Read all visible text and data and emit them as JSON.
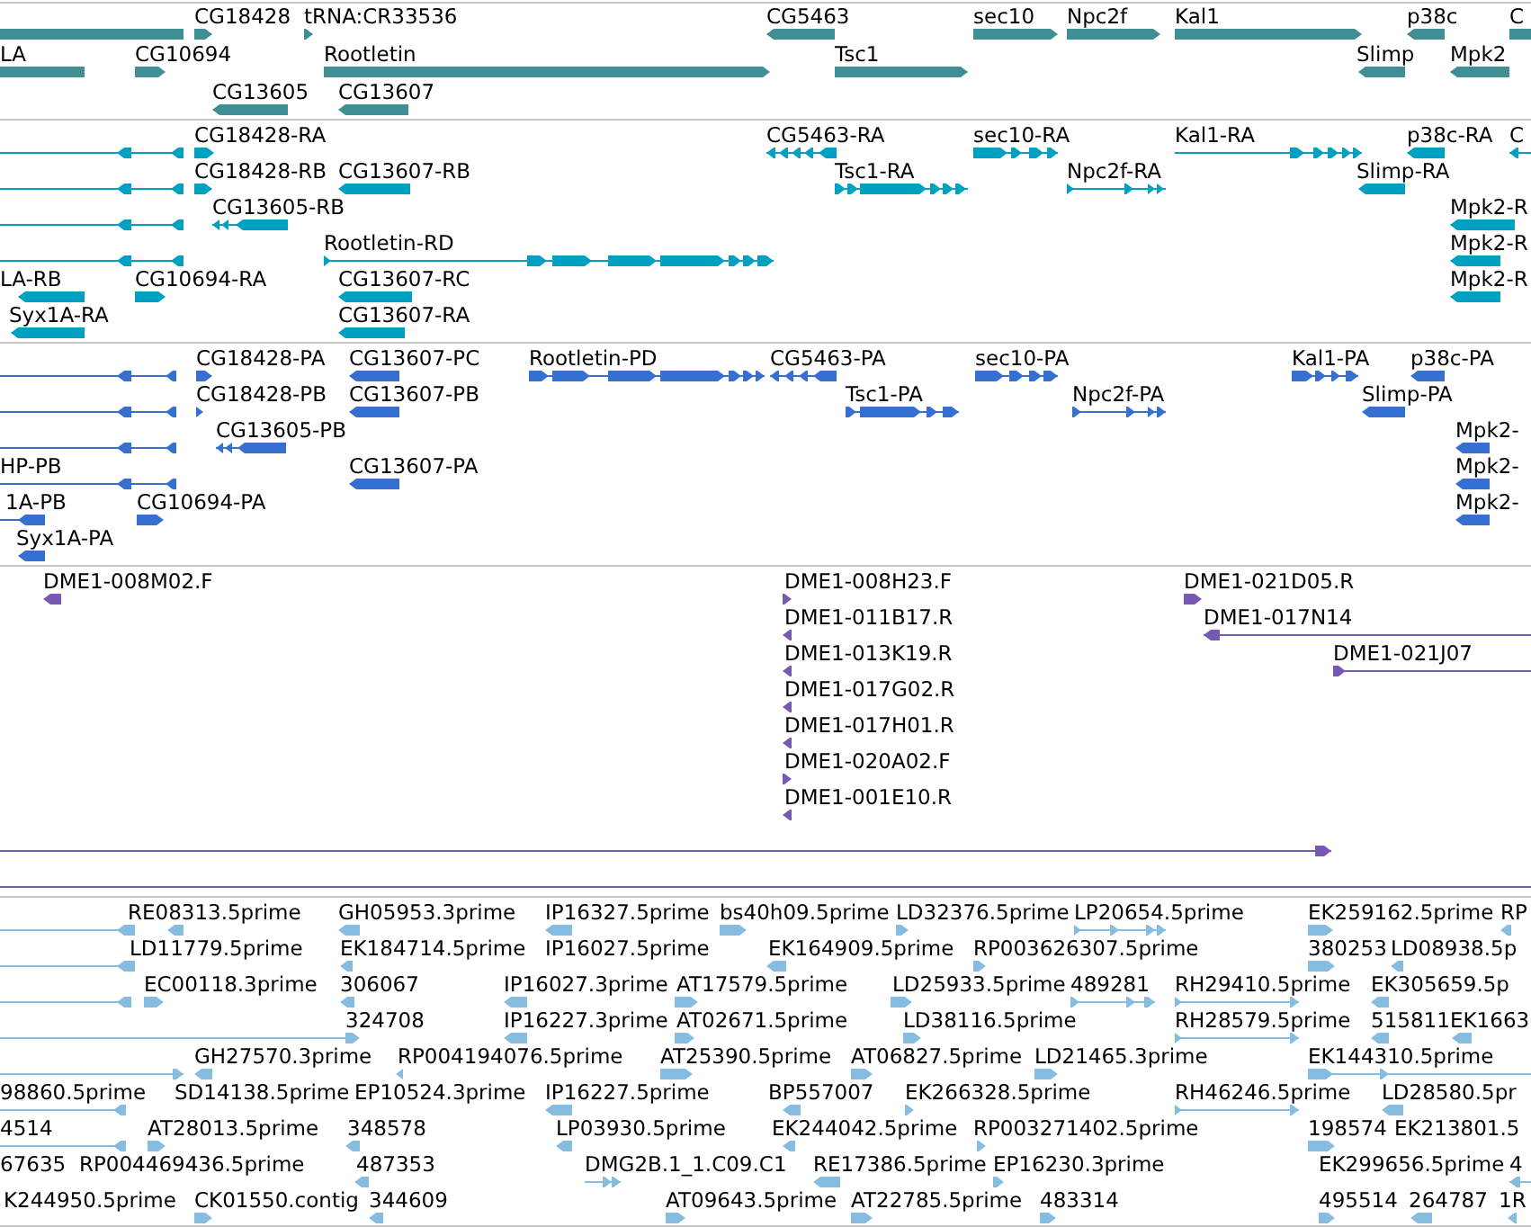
{
  "tracks": [
    {
      "color": "#408f95",
      "lanes": [
        {
          "features": [
            {
              "kind": "block"
            },
            {
              "label": "CG18428",
              "kind": "block",
              "forward": true
            },
            {
              "label": "tRNA:CR33536",
              "kind": "block",
              "forward": true
            },
            {
              "label": "CG5463",
              "kind": "block",
              "forward": false
            },
            {
              "label": "sec10",
              "kind": "block",
              "forward": true
            },
            {
              "label": "Npc2f",
              "kind": "block",
              "forward": true
            },
            {
              "label": "Kal1",
              "kind": "block",
              "forward": true
            },
            {
              "label": "p38c",
              "kind": "block",
              "forward": false
            },
            {
              "label": "C",
              "kind": "block"
            }
          ]
        },
        {
          "features": [
            {
              "label": "LA",
              "kind": "block"
            },
            {
              "label": "CG10694",
              "kind": "block",
              "forward": true
            },
            {
              "label": "Rootletin",
              "kind": "block",
              "forward": true
            },
            {
              "label": "Tsc1",
              "kind": "block",
              "forward": true
            },
            {
              "label": "Slimp",
              "kind": "block",
              "forward": false
            },
            {
              "label": "Mpk2",
              "kind": "block",
              "forward": false
            }
          ]
        },
        {
          "features": [
            {
              "label": "CG13605",
              "kind": "block",
              "forward": false
            },
            {
              "label": "CG13607",
              "kind": "block",
              "forward": false
            }
          ]
        }
      ]
    },
    {
      "color": "#00a0c0",
      "lanes": [
        {
          "features": [
            {
              "kind": "spliced",
              "forward": false
            },
            {
              "label": "CG18428-RA",
              "kind": "block",
              "forward": true
            },
            {
              "label": "CG5463-RA",
              "kind": "spliced",
              "forward": false
            },
            {
              "label": "sec10-RA",
              "kind": "spliced",
              "forward": true
            },
            {
              "label": "Kal1-RA",
              "kind": "spliced",
              "forward": true
            },
            {
              "label": "p38c-RA",
              "kind": "block",
              "forward": false
            },
            {
              "label": "C",
              "kind": "spliced",
              "forward": false
            }
          ]
        },
        {
          "features": [
            {
              "kind": "spliced",
              "forward": false
            },
            {
              "label": "CG18428-RB",
              "kind": "block",
              "forward": true
            },
            {
              "label": "CG13607-RB",
              "kind": "block",
              "forward": false
            },
            {
              "label": "Tsc1-RA",
              "kind": "spliced",
              "forward": true
            },
            {
              "label": "Npc2f-RA",
              "kind": "spliced",
              "forward": true
            },
            {
              "label": "Slimp-RA",
              "kind": "block",
              "forward": false
            }
          ]
        },
        {
          "features": [
            {
              "kind": "spliced",
              "forward": false
            },
            {
              "label": "CG13605-RB",
              "kind": "spliced",
              "forward": false
            },
            {
              "label": "Mpk2-R",
              "kind": "block",
              "forward": false
            }
          ]
        },
        {
          "features": [
            {
              "kind": "spliced",
              "forward": false
            },
            {
              "label": "Rootletin-RD",
              "kind": "spliced",
              "forward": true
            },
            {
              "label": "Mpk2-R",
              "kind": "block",
              "forward": false
            }
          ]
        },
        {
          "features": [
            {
              "label": "LA-RB",
              "kind": "block",
              "forward": false
            },
            {
              "label": "CG10694-RA",
              "kind": "block",
              "forward": true
            },
            {
              "label": "CG13607-RC",
              "kind": "block",
              "forward": false
            },
            {
              "label": "Mpk2-R",
              "kind": "block",
              "forward": false
            }
          ]
        },
        {
          "features": [
            {
              "label": "Syx1A-RA",
              "kind": "block",
              "forward": false
            },
            {
              "label": "CG13607-RA",
              "kind": "block",
              "forward": false
            }
          ]
        }
      ]
    },
    {
      "color": "#3570d0",
      "lanes": [
        {
          "features": [
            {
              "kind": "spliced",
              "forward": false
            },
            {
              "label": "CG18428-PA",
              "kind": "block",
              "forward": true
            },
            {
              "label": "CG13607-PC",
              "kind": "block",
              "forward": false
            },
            {
              "label": "Rootletin-PD",
              "kind": "spliced",
              "forward": true
            },
            {
              "label": "CG5463-PA",
              "kind": "spliced",
              "forward": false
            },
            {
              "label": "sec10-PA",
              "kind": "spliced",
              "forward": true
            },
            {
              "label": "Kal1-PA",
              "kind": "spliced",
              "forward": true
            },
            {
              "label": "p38c-PA",
              "kind": "block",
              "forward": false
            }
          ]
        },
        {
          "features": [
            {
              "kind": "spliced",
              "forward": false
            },
            {
              "label": "CG18428-PB",
              "kind": "block",
              "forward": true
            },
            {
              "label": "CG13607-PB",
              "kind": "block",
              "forward": false
            },
            {
              "label": "Tsc1-PA",
              "kind": "spliced",
              "forward": true
            },
            {
              "label": "Npc2f-PA",
              "kind": "spliced",
              "forward": true
            },
            {
              "label": "Slimp-PA",
              "kind": "block",
              "forward": false
            }
          ]
        },
        {
          "features": [
            {
              "kind": "spliced",
              "forward": false
            },
            {
              "label": "CG13605-PB",
              "kind": "spliced",
              "forward": false
            },
            {
              "label": "Mpk2-",
              "kind": "block",
              "forward": false
            }
          ]
        },
        {
          "features": [
            {
              "label": "HP-PB",
              "kind": "spliced",
              "forward": false
            },
            {
              "label": "CG13607-PA",
              "kind": "block",
              "forward": false
            },
            {
              "label": "Mpk2-",
              "kind": "block",
              "forward": false
            }
          ]
        },
        {
          "features": [
            {
              "label": "1A-PB",
              "kind": "spliced",
              "forward": false
            },
            {
              "label": "CG10694-PA",
              "kind": "block",
              "forward": true
            },
            {
              "label": "Mpk2-",
              "kind": "block",
              "forward": false
            }
          ]
        },
        {
          "features": [
            {
              "label": "Syx1A-PA",
              "kind": "block",
              "forward": false
            }
          ]
        }
      ]
    },
    {
      "color": "#7758b3",
      "lanes": [
        {
          "features": [
            {
              "label": "DME1-008M02.F",
              "kind": "block",
              "forward": false
            },
            {
              "label": "DME1-008H23.F",
              "kind": "block",
              "forward": true
            },
            {
              "label": "DME1-021D05.R",
              "kind": "block",
              "forward": true
            }
          ]
        },
        {
          "features": [
            {
              "label": "DME1-011B17.R",
              "kind": "block",
              "forward": false
            },
            {
              "label": "DME1-017N14",
              "kind": "spliced",
              "forward": false
            }
          ]
        },
        {
          "features": [
            {
              "label": "DME1-013K19.R",
              "kind": "block",
              "forward": false
            },
            {
              "label": "DME1-021J07",
              "kind": "spliced",
              "forward": true
            }
          ]
        },
        {
          "features": [
            {
              "label": "DME1-017G02.R",
              "kind": "block",
              "forward": false
            }
          ]
        },
        {
          "features": [
            {
              "label": "DME1-017H01.R",
              "kind": "block",
              "forward": false
            }
          ]
        },
        {
          "features": [
            {
              "label": "DME1-020A02.F",
              "kind": "block",
              "forward": true
            }
          ]
        },
        {
          "features": [
            {
              "label": "DME1-001E10.R",
              "kind": "block",
              "forward": false
            }
          ]
        },
        {
          "features": [
            {
              "kind": "spliced",
              "forward": true
            }
          ]
        },
        {
          "features": [
            {
              "kind": "spliced"
            }
          ]
        }
      ]
    },
    {
      "color": "#86bce0",
      "lanes": [
        {
          "features": [
            {
              "kind": "spliced",
              "forward": false
            },
            {
              "label": "RE08313.5prime",
              "kind": "block",
              "forward": false
            },
            {
              "label": "GH05953.3prime",
              "kind": "block",
              "forward": false
            },
            {
              "label": "IP16327.5prime",
              "kind": "block",
              "forward": false
            },
            {
              "label": "bs40h09.5prime",
              "kind": "block",
              "forward": true
            },
            {
              "label": "LD32376.5prime",
              "kind": "block",
              "forward": true
            },
            {
              "label": "LP20654.5prime",
              "kind": "spliced",
              "forward": true
            },
            {
              "label": "EK259162.5prime",
              "kind": "block",
              "forward": true
            },
            {
              "label": "RP",
              "kind": "block",
              "forward": false
            }
          ]
        },
        {
          "features": [
            {
              "kind": "spliced",
              "forward": false
            },
            {
              "label": "LD11779.5prime"
            },
            {
              "label": "EK184714.5prime",
              "kind": "block",
              "forward": false
            },
            {
              "label": "IP16027.5prime"
            },
            {
              "label": "EK164909.5prime",
              "kind": "block",
              "forward": false
            },
            {
              "label": "RP003626307.5prime",
              "kind": "block",
              "forward": true
            },
            {
              "label": "380253",
              "kind": "block",
              "forward": true
            },
            {
              "label": "LD08938.5p",
              "kind": "block",
              "forward": false
            }
          ]
        },
        {
          "features": [
            {
              "kind": "spliced",
              "forward": false
            },
            {
              "label": "EC00118.3prime",
              "kind": "block",
              "forward": true
            },
            {
              "label": "306067",
              "kind": "block",
              "forward": false
            },
            {
              "label": "IP16027.3prime",
              "kind": "block",
              "forward": false
            },
            {
              "label": "AT17579.5prime",
              "kind": "block",
              "forward": true
            },
            {
              "label": "LD25933.5prime",
              "kind": "block",
              "forward": true
            },
            {
              "label": "489281",
              "kind": "spliced",
              "forward": true
            },
            {
              "label": "RH29410.5prime",
              "kind": "spliced",
              "forward": true
            },
            {
              "label": "EK305659.5p",
              "kind": "block",
              "forward": false
            }
          ]
        },
        {
          "features": [
            {
              "kind": "spliced"
            },
            {
              "label": "324708",
              "kind": "block",
              "forward": true
            },
            {
              "label": "IP16227.3prime",
              "kind": "block",
              "forward": false
            },
            {
              "label": "AT02671.5prime",
              "kind": "block",
              "forward": true
            },
            {
              "label": "LD38116.5prime",
              "kind": "block",
              "forward": true
            },
            {
              "label": "RH28579.5prime",
              "kind": "spliced",
              "forward": true
            },
            {
              "label": "515811",
              "kind": "block",
              "forward": false
            },
            {
              "label": "EK1663",
              "kind": "block",
              "forward": false
            }
          ]
        },
        {
          "features": [
            {
              "kind": "spliced",
              "forward": true
            },
            {
              "label": "GH27570.3prime",
              "kind": "block",
              "forward": false
            },
            {
              "label": "RP004194076.5prime",
              "kind": "block",
              "forward": false
            },
            {
              "label": "AT25390.5prime",
              "kind": "block",
              "forward": true
            },
            {
              "label": "AT06827.5prime",
              "kind": "block",
              "forward": true
            },
            {
              "label": "LD21465.3prime",
              "kind": "block",
              "forward": true
            },
            {
              "label": "EK144310.5prime",
              "kind": "spliced",
              "forward": true
            }
          ]
        },
        {
          "features": [
            {
              "label": "98860.5prime",
              "kind": "spliced",
              "forward": false
            },
            {
              "label": "SD14138.5prime"
            },
            {
              "label": "EP10524.3prime"
            },
            {
              "label": "IP16227.5prime",
              "kind": "block",
              "forward": false
            },
            {
              "label": "BP557007",
              "kind": "block",
              "forward": false
            },
            {
              "label": "EK266328.5prime",
              "kind": "block",
              "forward": true
            },
            {
              "label": "RH46246.5prime",
              "kind": "spliced",
              "forward": true
            },
            {
              "label": "LD28580.5pr",
              "kind": "block",
              "forward": false
            }
          ]
        },
        {
          "features": [
            {
              "label": "4514",
              "kind": "spliced",
              "forward": false
            },
            {
              "label": "AT28013.5prime",
              "kind": "block",
              "forward": true
            },
            {
              "label": "348578",
              "kind": "block",
              "forward": false
            },
            {
              "label": "LP03930.5prime",
              "kind": "block",
              "forward": false
            },
            {
              "label": "EK244042.5prime",
              "kind": "block",
              "forward": false
            },
            {
              "label": "RP003271402.5prime",
              "kind": "block",
              "forward": true
            },
            {
              "label": "198574",
              "kind": "block",
              "forward": true
            },
            {
              "label": "EK213801.5"
            }
          ]
        },
        {
          "features": [
            {
              "label": "67635"
            },
            {
              "label": "RP004469436.5prime"
            },
            {
              "label": "487353",
              "kind": "block",
              "forward": false
            },
            {
              "label": "DMG2B.1_1.C09.C1",
              "kind": "spliced",
              "forward": true
            },
            {
              "label": "RE17386.5prime",
              "kind": "block",
              "forward": false
            },
            {
              "label": "EP16230.3prime",
              "kind": "block",
              "forward": true
            },
            {
              "label": "EK299656.5prime"
            },
            {
              "label": "4",
              "kind": "spliced",
              "forward": false
            }
          ]
        },
        {
          "features": [
            {
              "label": "K244950.5prime"
            },
            {
              "label": "CK01550.contig",
              "kind": "block",
              "forward": true
            },
            {
              "label": "344609",
              "kind": "block",
              "forward": false
            },
            {
              "label": "AT09643.5prime",
              "kind": "block",
              "forward": true
            },
            {
              "label": "AT22785.5prime",
              "kind": "block",
              "forward": true
            },
            {
              "label": "483314",
              "kind": "block",
              "forward": true
            },
            {
              "label": "495514",
              "kind": "block",
              "forward": true
            },
            {
              "label": "264787",
              "kind": "block",
              "forward": false
            },
            {
              "label": "1R",
              "kind": "block",
              "forward": false
            }
          ]
        }
      ]
    }
  ]
}
